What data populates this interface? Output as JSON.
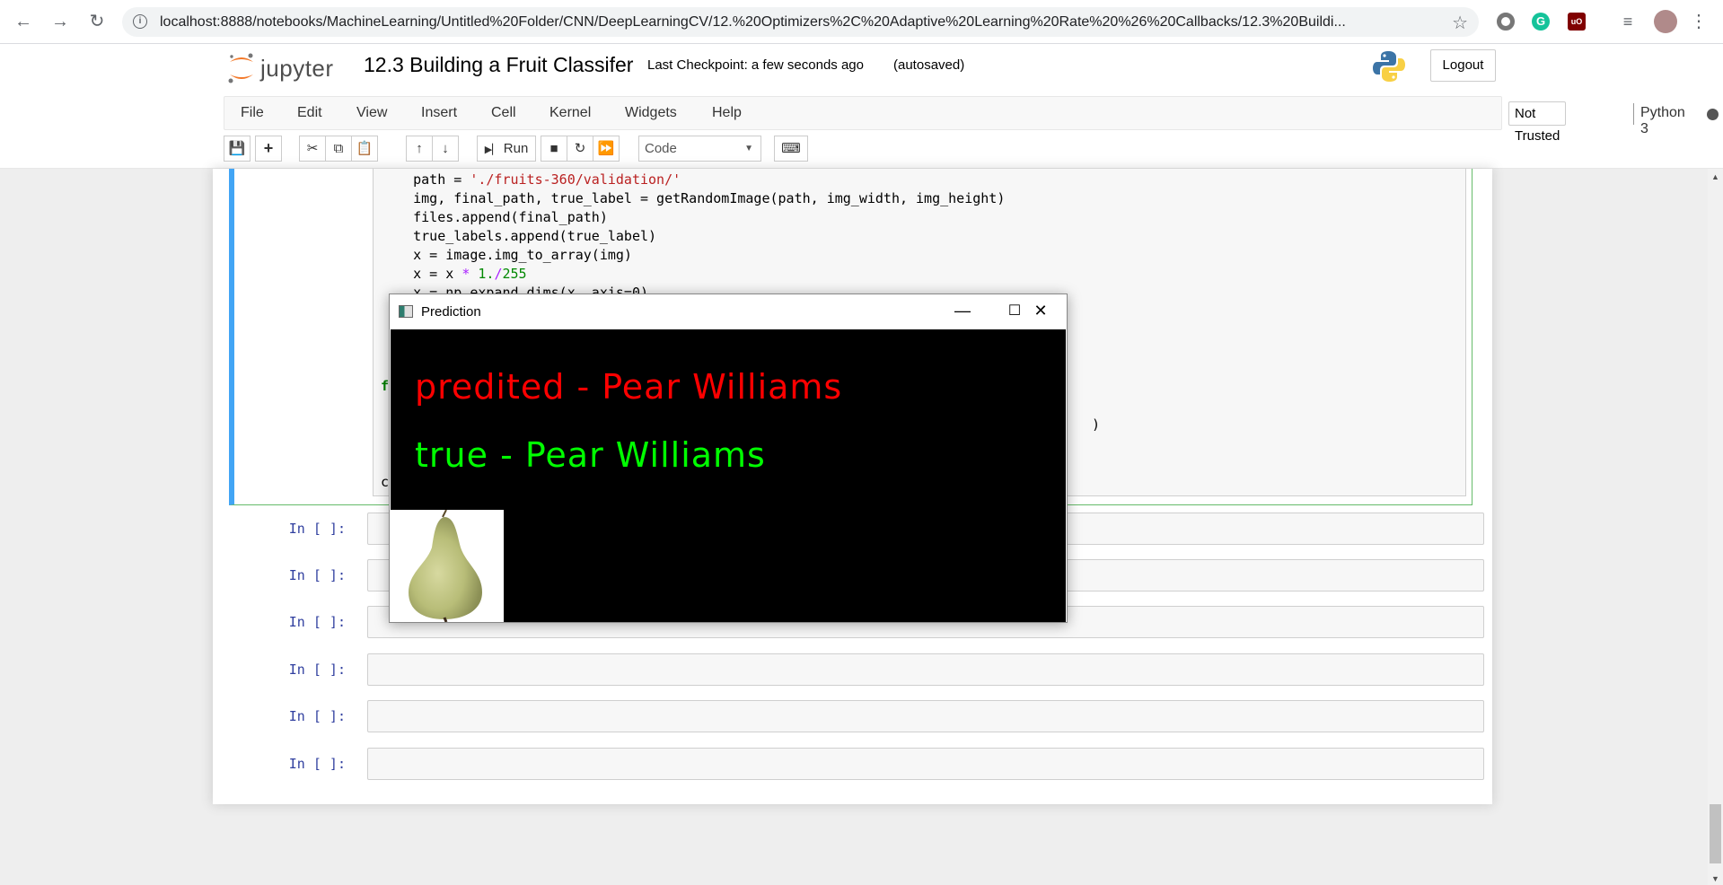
{
  "browser": {
    "url": "localhost:8888/notebooks/MachineLearning/Untitled%20Folder/CNN/DeepLearningCV/12.%20Optimizers%2C%20Adaptive%20Learning%20Rate%20%26%20Callbacks/12.3%20Buildi..."
  },
  "header": {
    "logo_text": "jupyter",
    "notebook_title": "12.3 Building a Fruit Classifer",
    "checkpoint": "Last Checkpoint: a few seconds ago",
    "autosave": "(autosaved)",
    "logout_label": "Logout"
  },
  "menu": {
    "items": [
      "File",
      "Edit",
      "View",
      "Insert",
      "Cell",
      "Kernel",
      "Widgets",
      "Help"
    ],
    "trust": "Not Trusted",
    "kernel": "Python 3"
  },
  "toolbar": {
    "run_label": "Run",
    "cell_type": "Code"
  },
  "code": {
    "lines": [
      {
        "text": "    path = "
      },
      {
        "text": "    img, final_path, true_label = getRandomImage(path, img_width, img_height)"
      },
      {
        "text": "    files.append(final_path)"
      },
      {
        "text": "    true_labels.append(true_label)"
      },
      {
        "text": "    x = image.img_to_array(img)"
      },
      {
        "text": "    x = x "
      },
      {
        "text": "    x = np.expand_dims(x, axis=0)"
      }
    ],
    "path_string": "'./fruits-360/validation/'",
    "for_keyword": "for",
    "tail_paren": ")",
    "last_line": "cv2."
  },
  "empty_cells": {
    "prompt": "In [ ]:",
    "count": 6
  },
  "prediction_window": {
    "title": "Prediction",
    "predicted_text": "predited - Pear Williams",
    "true_text": "true - Pear Williams",
    "predicted_color": "#ff0000",
    "true_color": "#00ff00"
  }
}
